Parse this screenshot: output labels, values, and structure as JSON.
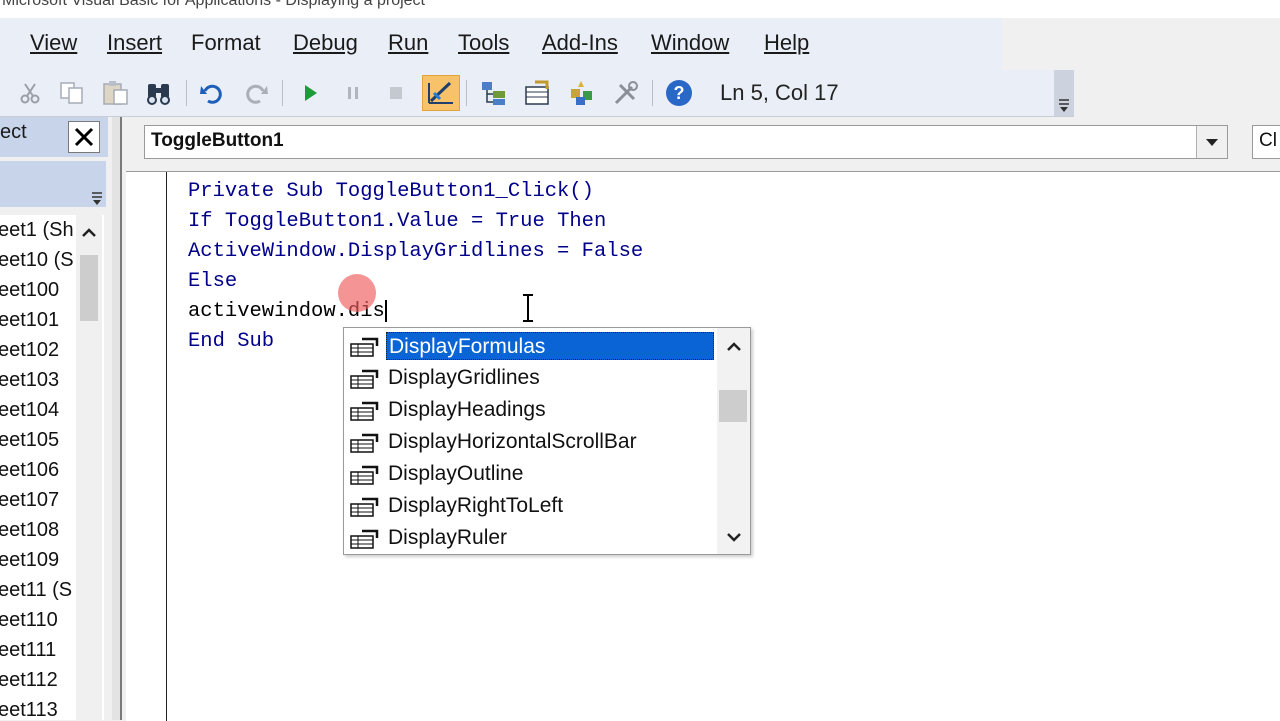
{
  "window": {
    "title_partial": "Microsoft Visual Basic for Applications - Displaying a project"
  },
  "menu": [
    "View",
    "Insert",
    "Format",
    "Debug",
    "Run",
    "Tools",
    "Add-Ins",
    "Window",
    "Help"
  ],
  "toolbar": {
    "status": "Ln 5, Col 17",
    "icons": [
      "cut-icon",
      "copy-icon",
      "paste-icon",
      "find-icon",
      "undo-icon",
      "redo-icon",
      "run-icon",
      "break-icon",
      "reset-icon",
      "design-mode-icon",
      "project-explorer-icon",
      "properties-icon",
      "object-browser-icon",
      "toolbox-icon",
      "help-icon"
    ]
  },
  "project": {
    "title": "ect",
    "items": [
      "eet1 (Sh",
      "eet10 (S",
      "eet100",
      "eet101",
      "eet102",
      "eet103",
      "eet104",
      "eet105",
      "eet106",
      "eet107",
      "eet108",
      "eet109",
      "eet11 (S",
      "eet110",
      "eet111",
      "eet112",
      "eet113"
    ]
  },
  "code": {
    "object_combo": "ToggleButton1",
    "procedure_combo": "Cl",
    "lines": [
      {
        "parts": [
          {
            "t": "Private Sub ",
            "k": true
          },
          {
            "t": "ToggleButton1_Click()",
            "k": false
          }
        ]
      },
      {
        "parts": [
          {
            "t": "If ",
            "k": true
          },
          {
            "t": "ToggleButton1.Value = ",
            "k": false
          },
          {
            "t": "True Then",
            "k": true
          }
        ]
      },
      {
        "parts": [
          {
            "t": "ActiveWindow.DisplayGridlines = ",
            "k": false
          },
          {
            "t": "False",
            "k": true
          }
        ]
      },
      {
        "parts": [
          {
            "t": "Else",
            "k": true
          }
        ]
      },
      {
        "parts": [
          {
            "t": "activewindow.dis",
            "k": false
          }
        ]
      },
      {
        "parts": [
          {
            "t": "End Sub",
            "k": true
          }
        ]
      }
    ]
  },
  "autocomplete": {
    "selected_index": 0,
    "items": [
      "DisplayFormulas",
      "DisplayGridlines",
      "DisplayHeadings",
      "DisplayHorizontalScrollBar",
      "DisplayOutline",
      "DisplayRightToLeft",
      "DisplayRuler"
    ]
  },
  "colors": {
    "keyword": "#00008b",
    "selection": "#0a64d6",
    "menubar": "#eaeef6",
    "pane_header": "#c7d4e9"
  }
}
